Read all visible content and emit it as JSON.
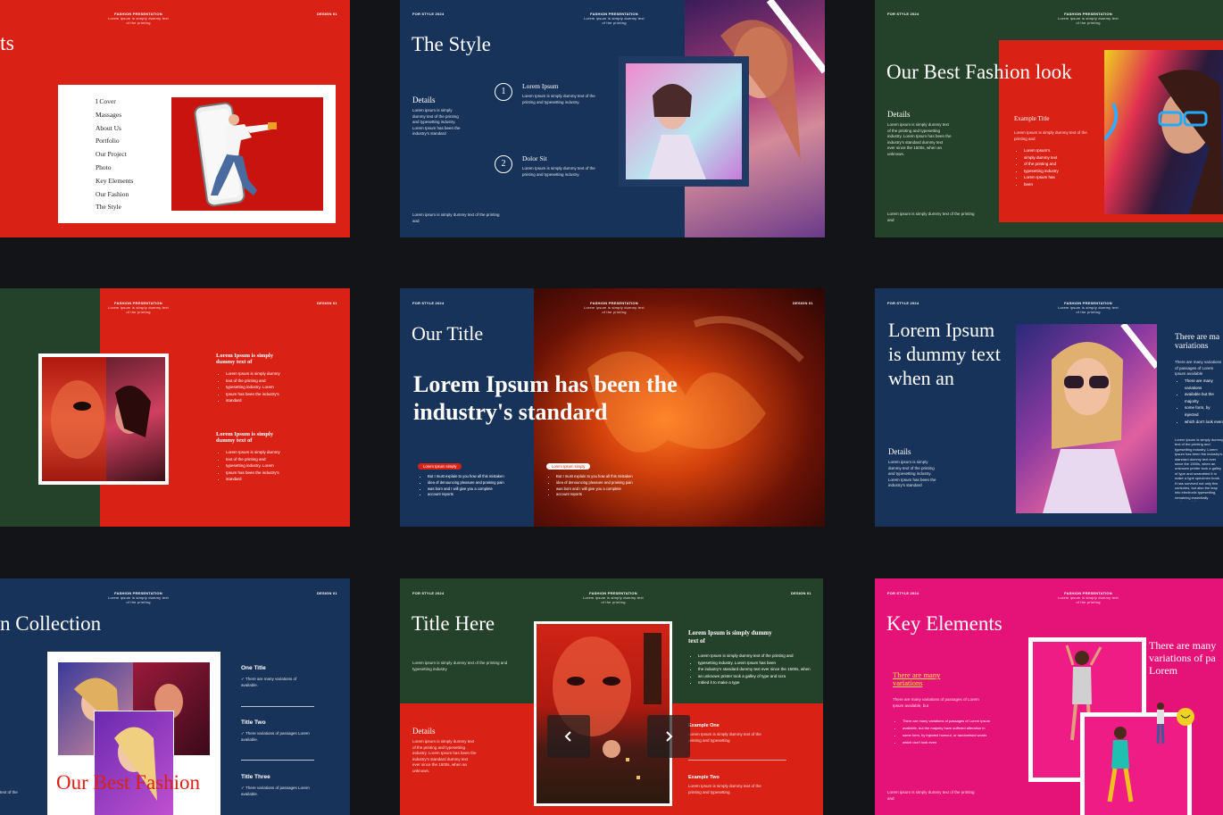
{
  "colors": {
    "bg": "#131417",
    "red": "#da2116",
    "navy": "#18335a",
    "green": "#24412a",
    "pink": "#e51378"
  },
  "common": {
    "brand": "FASHION PRESENTATION",
    "brand_sub1": "Lorem ipsum is simply dummy text",
    "brand_sub2": "of the printing",
    "style": "FOR STYLE 2024",
    "design": "DESIGN 01"
  },
  "slide1": {
    "title": "ts",
    "menu": [
      "I Cover",
      "Massages",
      "About Us",
      "Portfolio",
      "Our Project",
      "Photo",
      "Key Elements",
      "Our Fashion",
      "The Style"
    ]
  },
  "slide2": {
    "title": "The Style",
    "details": "Details",
    "details_text": "Lorem ipsum is simply dummy text of the printing and typesetting industry. Lorem Ipsum has been the industry's standard",
    "footer": "Lorem ipsum is simply dummy text of the printing and",
    "items": [
      {
        "num": "1",
        "title": "Lorem Ipsum",
        "text": "Lorem Ipsum is simply dummy text of the printing and typesetting industry."
      },
      {
        "num": "2",
        "title": "Dolor Sit",
        "text": "Lorem Ipsum is simply dummy text of the printing and typesetting industry."
      }
    ]
  },
  "slide3": {
    "title": "Our Best Fashion look",
    "details": "Details",
    "details_text": "Lorem ipsum is simply dummy text of the printing and typesetting industry. Lorem Ipsum has been the industry's standard dummy text ever since the 1500s, when an unknown.",
    "footer": "Lorem ipsum is simply dummy text of the printing and",
    "example_title": "Example Title",
    "example_text": "Lorem Ipsum is simply dummy text of the printing and",
    "bullets": [
      "Lorem Ipsum's",
      "simply dummy text",
      "of the printing and",
      "typesetting industry",
      "Lorem Ipsum has",
      "been"
    ]
  },
  "slide4": {
    "blocks": [
      {
        "title": "Lorem Ipsum is simply dummy text of",
        "bullets": [
          "Lorem Ipsum is simply dummy",
          "text of the printing and",
          "typesetting industry. Lorem",
          "Ipsum has been the industry's",
          "standard"
        ]
      },
      {
        "title": "Lorem Ipsum is simply dummy text of",
        "bullets": [
          "Lorem Ipsum is simply dummy",
          "text of the printing and",
          "typesetting industry. Lorem",
          "Ipsum has been the industry's",
          "standard"
        ]
      }
    ]
  },
  "slide5": {
    "title": "Our Title",
    "headline": "Lorem Ipsum has been the industry's standard",
    "pill1": "Lorem Ipsum simply",
    "pill2": "Lorem Ipsum simply",
    "bullets1": [
      "But I must explain to you how all this mistaken",
      "idea of denouncing pleasure and praising pain",
      "was born and I will give you a complete",
      "account reports"
    ],
    "bullets2": [
      "But I must explain to you how all this mistaken",
      "idea of denouncing pleasure and praising pain",
      "was born and I will give you a complete",
      "account reports"
    ]
  },
  "slide6": {
    "title": "Lorem Ipsum is dummy text when an",
    "details": "Details",
    "details_text": "Lorem ipsum is simply dummy text of the printing and typesetting industry. Lorem Ipsum has been the industry's standard",
    "side_title": "There are ma variations",
    "side_text": "There are many variations of passages of Lorem Ipsum available",
    "bullets": [
      "There are many variations",
      "available but the majority",
      "some form, by injected",
      "which don't look even"
    ],
    "body": "Lorem Ipsum is simply dummy text of the printing and typesetting industry. Lorem Ipsum has been the industry's standard dummy text ever since the 1500s, when an unknown printer took a galley of type and scrambled it to make a type specimen book. It has survived not only five centuries, but also the leap into electronic typesetting, remaining essentially unchanged. It was popularised in the 1960s with the release of Letraset sheets containing Lorem Ipsum passages, and more recently with desktop publishing software like Aldus PageMaker including versions of Lorem Ipsum."
  },
  "slide7": {
    "title": "n Collection",
    "image_caption": "Our Best Fashion",
    "footer": "text of the",
    "items": [
      {
        "title": "One Title",
        "text": "There are many variations of available."
      },
      {
        "title": "Title Two",
        "text": "There variations of passages Lorem available."
      },
      {
        "title": "Title Three",
        "text": "There variations of passages Lorem available."
      }
    ]
  },
  "slide8": {
    "title": "Title Here",
    "intro": "Lorem ipsum is simply dummy text of the printing and typesetting industry",
    "details": "Details",
    "details_text": "Lorem ipsum is simply dummy text of the printing and typesetting industry. Lorem Ipsum has been the industry's standard dummy text ever since the 1500s, when an unknown.",
    "right_title": "Lorem Ipsum is simply dummy text of",
    "bullets": [
      "Lorem Ipsum is simply dummy text of the printing and",
      "typesetting industry. Lorem Ipsum has been",
      "the industry's standard dummy text ever since the 1500s, when",
      "an unknown printer took a galley of type and scra",
      "mbled it to make a type"
    ],
    "ex1_title": "Example One",
    "ex1_text": "Lorem Ipsum is simply dummy text of the printing and typesetting",
    "ex2_title": "Example Two",
    "ex2_text": "Lorem Ipsum is simply dummy text of the printing and typesetting"
  },
  "slide9": {
    "title": "Key Elements",
    "subtitle": "There are many variations",
    "text": "There are many variations of passages of Lorem Ipsum available, but",
    "bullets": [
      "There are many variations of passages of Lorem Ipsum",
      "available, but the majority have suffered alteration in",
      "some form, by injected humour, or randomised words",
      "which don't look even"
    ],
    "footer": "Lorem ipsum is simply dummy text of the printing and",
    "side_text": "There are many variations of pa Lorem"
  },
  "nav": {
    "prev_icon": "chevron-left-icon",
    "next_icon": "chevron-right-icon"
  }
}
